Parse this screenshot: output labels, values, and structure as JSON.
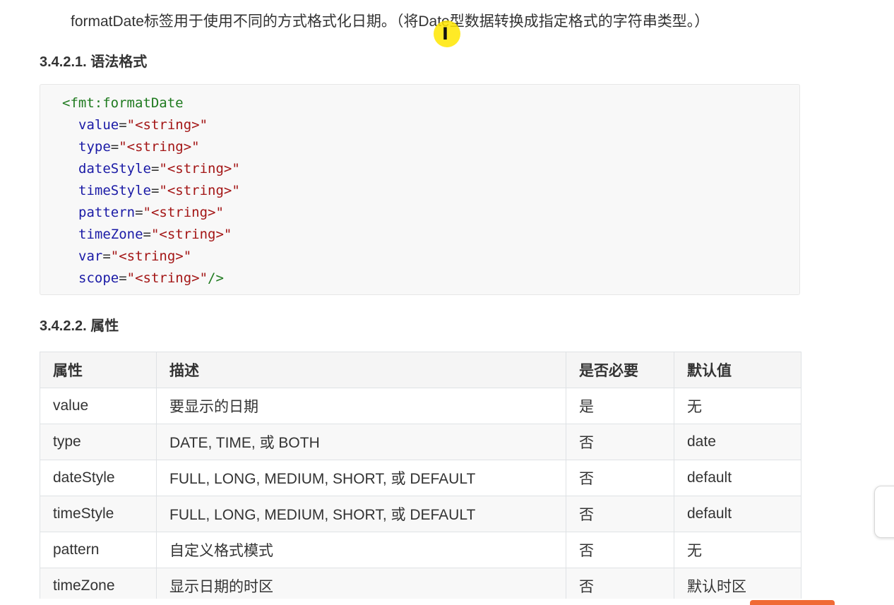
{
  "intro": "formatDate标签用于使用不同的方式格式化日期。（将Date型数据转换成指定格式的字符串类型。）",
  "syntax_heading": "3.4.2.1. 语法格式",
  "code": {
    "tag_open": "<fmt:formatDate",
    "attributes": [
      {
        "name": "value",
        "eq": "=",
        "value": "\"<string>\"",
        "close": ""
      },
      {
        "name": "type",
        "eq": "=",
        "value": "\"<string>\"",
        "close": ""
      },
      {
        "name": "dateStyle",
        "eq": "=",
        "value": "\"<string>\"",
        "close": ""
      },
      {
        "name": "timeStyle",
        "eq": "=",
        "value": "\"<string>\"",
        "close": ""
      },
      {
        "name": "pattern",
        "eq": "=",
        "value": "\"<string>\"",
        "close": ""
      },
      {
        "name": "timeZone",
        "eq": "=",
        "value": "\"<string>\"",
        "close": ""
      },
      {
        "name": "var",
        "eq": "=",
        "value": "\"<string>\"",
        "close": ""
      },
      {
        "name": "scope",
        "eq": "=",
        "value": "\"<string>\"",
        "close": "/>"
      }
    ]
  },
  "attrs_heading": "3.4.2.2. 属性",
  "table": {
    "headers": [
      "属性",
      "描述",
      "是否必要",
      "默认值"
    ],
    "rows": [
      [
        "value",
        "要显示的日期",
        "是",
        "无"
      ],
      [
        "type",
        "DATE, TIME, 或 BOTH",
        "否",
        "date"
      ],
      [
        "dateStyle",
        "FULL, LONG, MEDIUM, SHORT, 或 DEFAULT",
        "否",
        "default"
      ],
      [
        "timeStyle",
        "FULL, LONG, MEDIUM, SHORT, 或 DEFAULT",
        "否",
        "default"
      ],
      [
        "pattern",
        "自定义格式模式",
        "否",
        "无"
      ],
      [
        "timeZone",
        "显示日期的时区",
        "否",
        "默认时区"
      ]
    ]
  },
  "colors": {
    "tag": "#1f7a1f",
    "attr": "#1a1aa6",
    "string": "#a31515",
    "cursor_highlight": "#ffe600"
  },
  "icons": {
    "cursor": "text-cursor-icon"
  }
}
